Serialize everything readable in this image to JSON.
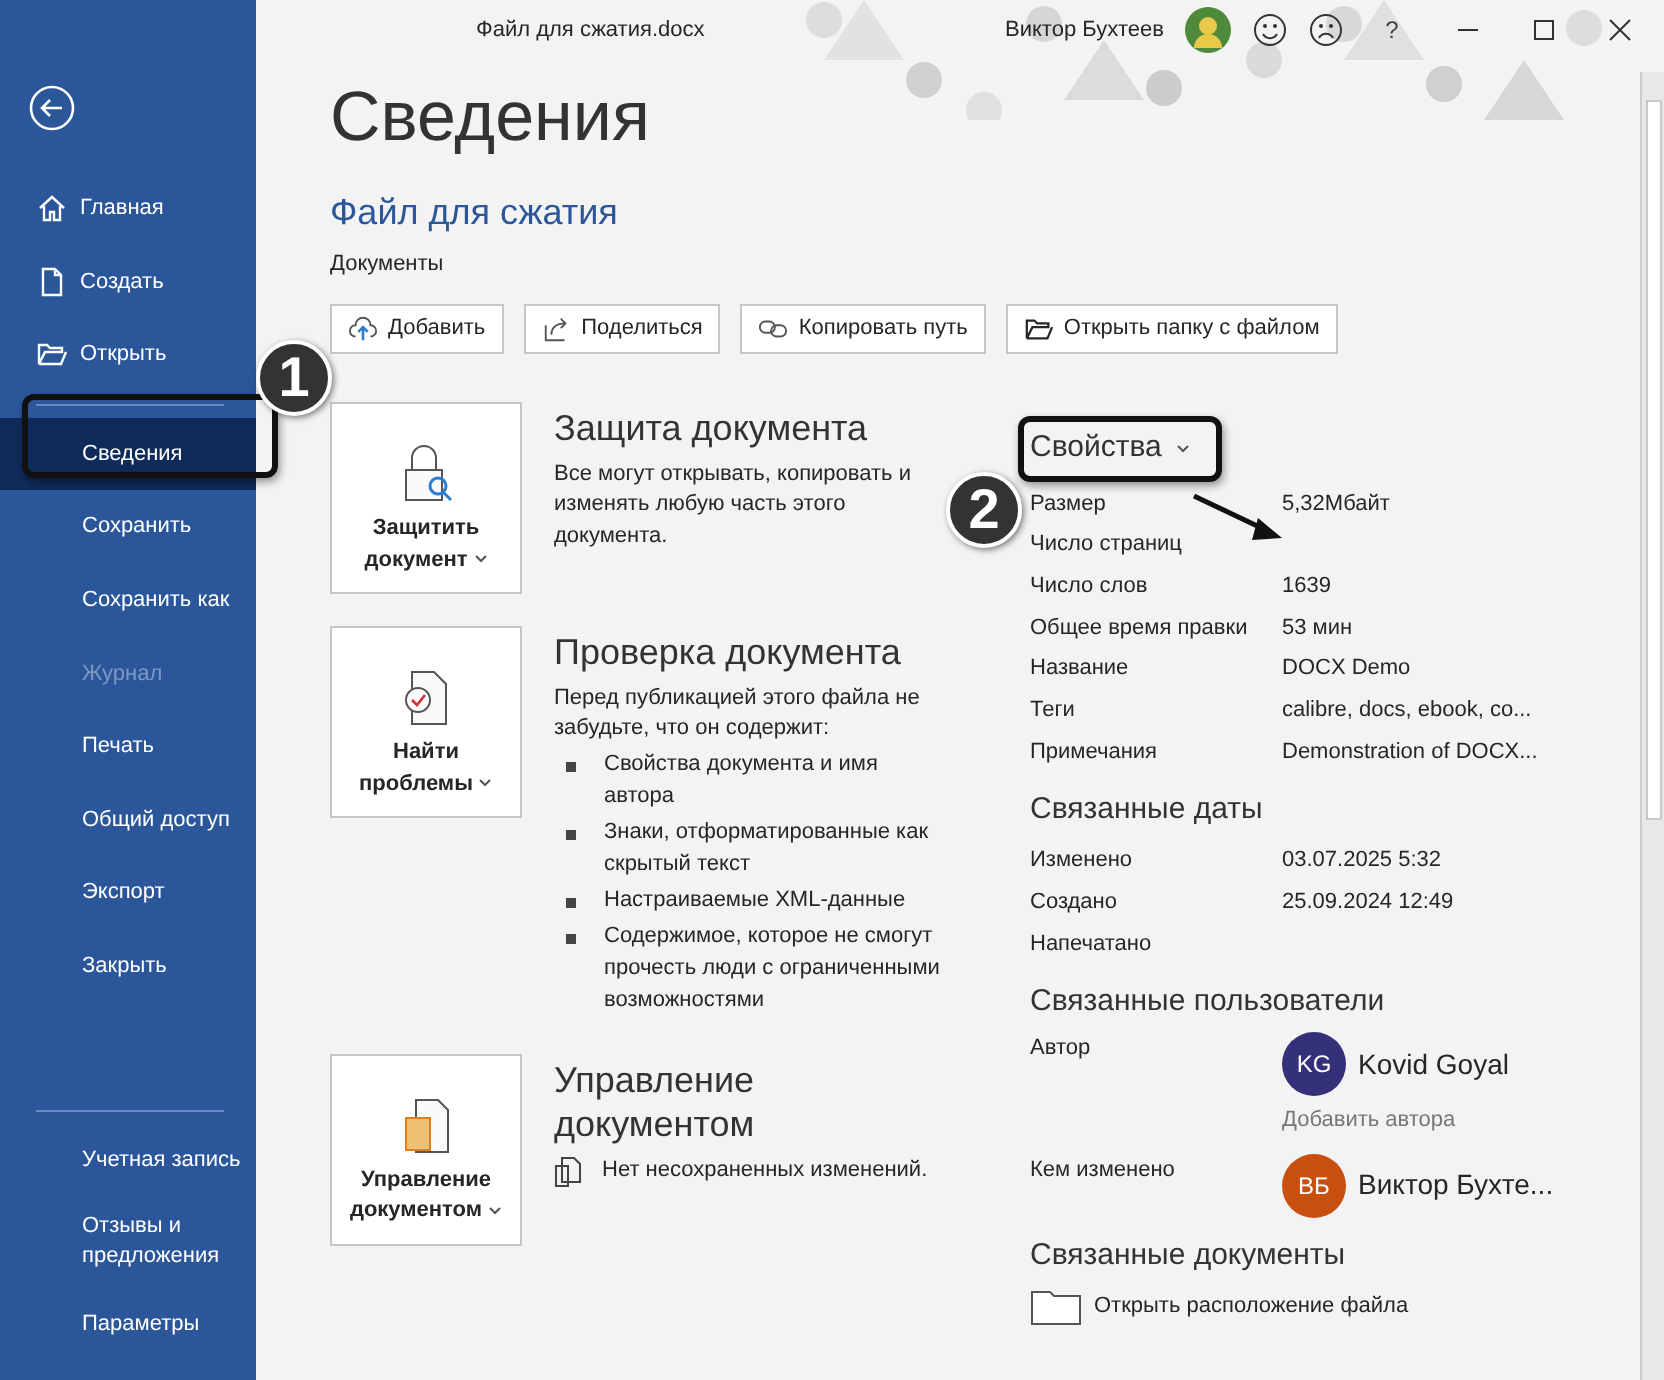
{
  "window": {
    "title": "Файл для сжатия.docx",
    "user": "Виктор Бухтеев",
    "help": "?"
  },
  "sidebar": {
    "items": [
      {
        "label": "Главная",
        "kind": "icon",
        "selected": false,
        "disabled": false
      },
      {
        "label": "Создать",
        "kind": "icon",
        "selected": false,
        "disabled": false
      },
      {
        "label": "Открыть",
        "kind": "icon",
        "selected": false,
        "disabled": false
      },
      {
        "label": "Сведения",
        "selected": true,
        "disabled": false
      },
      {
        "label": "Сохранить",
        "selected": false,
        "disabled": false
      },
      {
        "label": "Сохранить как",
        "selected": false,
        "disabled": false
      },
      {
        "label": "Журнал",
        "selected": false,
        "disabled": true
      },
      {
        "label": "Печать",
        "selected": false,
        "disabled": false
      },
      {
        "label": "Общий доступ",
        "selected": false,
        "disabled": false
      },
      {
        "label": "Экспорт",
        "selected": false,
        "disabled": false
      },
      {
        "label": "Закрыть",
        "selected": false,
        "disabled": false
      }
    ],
    "bottom_items": [
      {
        "label": "Учетная запись"
      },
      {
        "label": "Отзывы и предложения"
      },
      {
        "label": "Параметры"
      }
    ]
  },
  "page": {
    "heading": "Сведения",
    "file_name": "Файл для сжатия",
    "location": "Документы",
    "actions": [
      {
        "label": "Добавить"
      },
      {
        "label": "Поделиться"
      },
      {
        "label": "Копировать путь"
      },
      {
        "label": "Открыть папку с файлом"
      }
    ],
    "sections": [
      {
        "button": "Защитить документ",
        "title": "Защита документа",
        "text": "Все могут открывать, копировать и изменять любую часть этого документа."
      },
      {
        "button": "Найти проблемы",
        "title": "Проверка документа",
        "text": "Перед публикацией этого файла не забудьте, что он содержит:",
        "bullets": [
          "Свойства документа и имя автора",
          "Знаки, отформатированные как скрытый текст",
          "Настраиваемые XML-данные",
          "Содержимое, которое не смогут прочесть люди с ограниченными возможностями"
        ]
      },
      {
        "button": "Управление документом",
        "title": "Управление документом",
        "note": "Нет несохраненных изменений."
      }
    ]
  },
  "properties": {
    "title": "Свойства",
    "rows": [
      {
        "label": "Размер",
        "value": "5,32Мбайт"
      },
      {
        "label": "Число страниц"
      },
      {
        "label": "Число слов",
        "value": "1639"
      },
      {
        "label": "Общее время правки",
        "value": "53 мин"
      },
      {
        "label": "Название",
        "value": "DOCX Demo"
      },
      {
        "label": "Теги",
        "value": "calibre, docs, ebook, co..."
      },
      {
        "label": "Примечания",
        "value": "Demonstration of DOCX..."
      }
    ]
  },
  "dates": {
    "title": "Связанные даты",
    "rows": [
      {
        "label": "Изменено",
        "value": "03.07.2025 5:32"
      },
      {
        "label": "Создано",
        "value": "25.09.2024 12:49"
      },
      {
        "label": "Напечатано"
      }
    ]
  },
  "people": {
    "title": "Связанные пользователи",
    "author_label": "Автор",
    "authors": [
      {
        "initials": "KG",
        "name": "Kovid Goyal",
        "color": "#35307a"
      }
    ],
    "add_author": "Добавить автора",
    "modified_label": "Кем изменено",
    "modified_by": [
      {
        "initials": "ВБ",
        "name": "Виктор Бухте...",
        "color": "#c94f0f"
      }
    ]
  },
  "documents": {
    "title": "Связанные документы",
    "link": "Открыть расположение файла"
  },
  "annotations": [
    {
      "number": "1"
    },
    {
      "number": "2"
    }
  ]
}
